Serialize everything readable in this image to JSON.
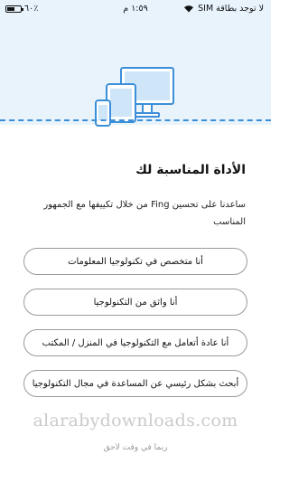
{
  "status_bar": {
    "carrier": "لا توجد بطاقة SIM",
    "time": "١:٥٩ م",
    "battery": "٦٠٪",
    "battery_level": 0.6
  },
  "onboarding": {
    "title": "الأداة المناسبة لك",
    "subtitle": "ساعدنا على تحسين Fing من خلال تكييفها مع الجمهور المناسب",
    "options": [
      "أنا متخصص في تكنولوجيا المعلومات",
      "أنا واثق من التكنولوجيا",
      "أنا عادة أتعامل مع التكنولوجيا في المنزل / المكتب",
      "أبحث بشكل رئيسي عن المساعدة في مجال التكنولوجيا"
    ],
    "later": "ربما في وقت لاحق"
  },
  "watermark": "alarabydownloads.com",
  "colors": {
    "accent": "#3b8fd8",
    "hero_bg": "#e8f3fc",
    "border": "#9a9a9a"
  },
  "illustration": "devices-icon"
}
